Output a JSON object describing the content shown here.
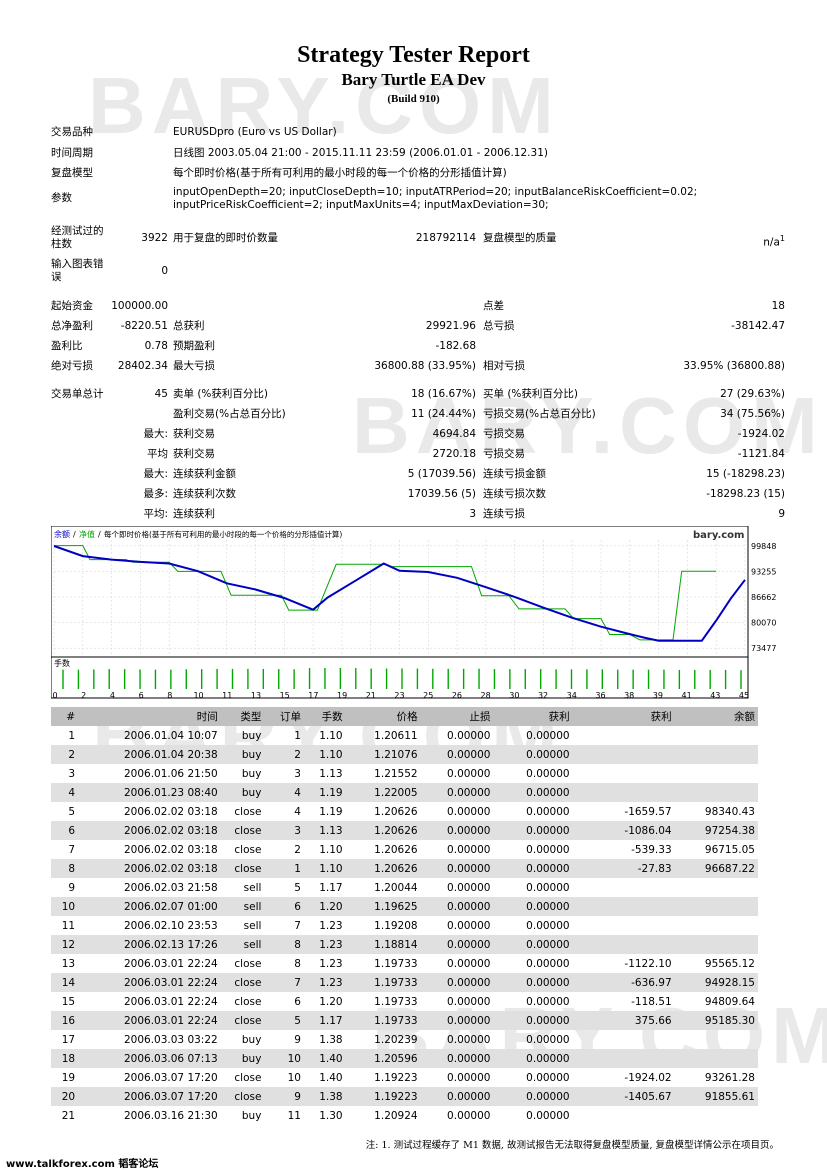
{
  "header": {
    "title": "Strategy Tester Report",
    "subtitle": "Bary Turtle EA Dev",
    "build": "(Build 910)",
    "watermark": "BARY.COM"
  },
  "info": {
    "symbol_label": "交易品种",
    "symbol": "EURUSDpro (Euro vs US Dollar)",
    "period_label": "时间周期",
    "period": "日线图 2003.05.04 21:00 - 2015.11.11 23:59 (2006.01.01 - 2006.12.31)",
    "model_label": "复盘模型",
    "model": "每个即时价格(基于所有可利用的最小时段的每一个价格的分形插值计算)",
    "params_label": "参数",
    "params_line1": "inputOpenDepth=20; inputCloseDepth=10; inputATRPeriod=20; inputBalanceRiskCoefficient=0.02;",
    "params_line2": "inputPriceRiskCoefficient=2; inputMaxUnits=4; inputMaxDeviation=30;",
    "bars_label": "经测试过的柱数",
    "bars": "3922",
    "ticks_label": "用于复盘的即时价数量",
    "ticks": "218792114",
    "quality_label": "复盘模型的质量",
    "quality": "n/a",
    "quality_sup": "1",
    "errors_label": "输入图表错误",
    "errors": "0"
  },
  "stats": {
    "deposit_label": "起始资金",
    "deposit": "100000.00",
    "spread_label": "点差",
    "spread": "18",
    "net_label": "总净盈利",
    "net": "-8220.51",
    "gross_profit_label": "总获利",
    "gross_profit": "29921.96",
    "gross_loss_label": "总亏损",
    "gross_loss": "-38142.47",
    "pf_label": "盈利比",
    "pf": "0.78",
    "payoff_label": "预期盈利",
    "payoff": "-182.68",
    "abs_dd_label": "绝对亏损",
    "abs_dd": "28402.34",
    "max_dd_label": "最大亏损",
    "max_dd": "36800.88 (33.95%)",
    "rel_dd_label": "相对亏损",
    "rel_dd": "33.95% (36800.88)",
    "total_label": "交易单总计",
    "total": "45",
    "short_label": "卖单 (%获利百分比)",
    "short": "18 (16.67%)",
    "long_label": "买单 (%获利百分比)",
    "long": "27 (29.63%)",
    "win_label": "盈利交易(%占总百分比)",
    "win": "11 (24.44%)",
    "loss_label": "亏损交易(%占总百分比)",
    "loss": "34 (75.56%)",
    "max_prefix": "最大:",
    "largest_win_label": "获利交易",
    "largest_win": "4694.84",
    "largest_loss_label": "亏损交易",
    "largest_loss": "-1924.02",
    "avg_prefix": "平均",
    "avg_win_label": "获利交易",
    "avg_win": "2720.18",
    "avg_loss_label": "亏损交易",
    "avg_loss": "-1121.84",
    "max2_prefix": "最大:",
    "cons_win_label": "连续获利金额",
    "cons_win": "5 (17039.56)",
    "cons_loss_label": "连续亏损金额",
    "cons_loss": "15 (-18298.23)",
    "most_prefix": "最多:",
    "cons_win_cnt_label": "连续获利次数",
    "cons_win_cnt": "17039.56 (5)",
    "cons_loss_cnt_label": "连续亏损次数",
    "cons_loss_cnt": "-18298.23 (15)",
    "avg2_prefix": "平均:",
    "avg_cons_win_label": "连续获利",
    "avg_cons_win": "3",
    "avg_cons_loss_label": "连续亏损",
    "avg_cons_loss": "9"
  },
  "chart_data": {
    "type": "line",
    "legend": [
      "余额",
      "净值",
      "每个即时价格(基于所有可利用的最小时段的每一个价格的分形插值计算)"
    ],
    "brand": "bary.com",
    "volume_label": "手数",
    "y_ticks": [
      "99848",
      "93255",
      "86662",
      "80070",
      "73477"
    ],
    "ylim": [
      73477,
      99848
    ],
    "xlim": [
      0,
      46
    ],
    "x_ticks": [
      "0",
      "2",
      "4",
      "6",
      "8",
      "10",
      "11",
      "13",
      "15",
      "17",
      "19",
      "21",
      "23",
      "25",
      "26",
      "28",
      "30",
      "32",
      "34",
      "36",
      "38",
      "39",
      "41",
      "43",
      "45"
    ],
    "series": [
      {
        "name": "余额",
        "color": "#00a800",
        "points": [
          [
            0,
            99900
          ],
          [
            2,
            99900
          ],
          [
            2.5,
            96300
          ],
          [
            5,
            96300
          ],
          [
            5.5,
            95600
          ],
          [
            8,
            95600
          ],
          [
            8.6,
            93262
          ],
          [
            11.6,
            93262
          ],
          [
            12.3,
            87100
          ],
          [
            15.8,
            87100
          ],
          [
            16.3,
            83300
          ],
          [
            18.3,
            83300
          ],
          [
            19.6,
            95100
          ],
          [
            22.9,
            95100
          ],
          [
            23.5,
            94500
          ],
          [
            29,
            94500
          ],
          [
            29.7,
            87000
          ],
          [
            31.6,
            87000
          ],
          [
            32.3,
            83600
          ],
          [
            35.5,
            83600
          ],
          [
            36.1,
            81100
          ],
          [
            38,
            81100
          ],
          [
            38.6,
            77000
          ],
          [
            40,
            77000
          ],
          [
            40.7,
            75600
          ],
          [
            43,
            75600
          ],
          [
            43.6,
            93300
          ],
          [
            46,
            93300
          ]
        ]
      },
      {
        "name": "净值",
        "color": "#0000c0",
        "points": [
          [
            0,
            99800
          ],
          [
            2,
            97200
          ],
          [
            4,
            96300
          ],
          [
            6,
            95700
          ],
          [
            8,
            95300
          ],
          [
            10,
            93300
          ],
          [
            12,
            90200
          ],
          [
            14,
            88600
          ],
          [
            16,
            86400
          ],
          [
            18,
            83400
          ],
          [
            19,
            86500
          ],
          [
            21,
            91000
          ],
          [
            22.9,
            95300
          ],
          [
            24,
            93400
          ],
          [
            26,
            93100
          ],
          [
            28,
            91600
          ],
          [
            30,
            89200
          ],
          [
            32,
            86700
          ],
          [
            34,
            83900
          ],
          [
            36,
            81300
          ],
          [
            38,
            79000
          ],
          [
            40,
            77100
          ],
          [
            41,
            76200
          ],
          [
            42,
            75400
          ],
          [
            44,
            75400
          ],
          [
            45,
            75400
          ],
          [
            46,
            80600
          ],
          [
            47,
            86200
          ],
          [
            48,
            91100
          ]
        ]
      }
    ],
    "volumes": [
      1.1,
      1.1,
      1.13,
      1.19,
      1.19,
      1.13,
      1.1,
      1.1,
      1.17,
      1.2,
      1.23,
      1.23,
      1.23,
      1.23,
      1.2,
      1.17,
      1.38,
      1.4,
      1.4,
      1.38,
      1.3,
      1.3,
      1.3,
      1.3,
      1.25,
      1.25,
      1.25,
      1.25,
      1.2,
      1.2,
      1.2,
      1.2,
      1.15,
      1.15,
      1.15,
      1.15,
      1.1,
      1.1,
      1.1,
      1.1,
      1.05,
      1.05,
      1.05,
      1.05,
      1.0
    ]
  },
  "table": {
    "headers": [
      "#",
      "时间",
      "类型",
      "订单",
      "手数",
      "价格",
      "止损",
      "获利",
      "获利",
      "余额"
    ],
    "rows": [
      [
        "1",
        "2006.01.04 10:07",
        "buy",
        "1",
        "1.10",
        "1.20611",
        "0.00000",
        "0.00000",
        "",
        ""
      ],
      [
        "2",
        "2006.01.04 20:38",
        "buy",
        "2",
        "1.10",
        "1.21076",
        "0.00000",
        "0.00000",
        "",
        ""
      ],
      [
        "3",
        "2006.01.06 21:50",
        "buy",
        "3",
        "1.13",
        "1.21552",
        "0.00000",
        "0.00000",
        "",
        ""
      ],
      [
        "4",
        "2006.01.23 08:40",
        "buy",
        "4",
        "1.19",
        "1.22005",
        "0.00000",
        "0.00000",
        "",
        ""
      ],
      [
        "5",
        "2006.02.02 03:18",
        "close",
        "4",
        "1.19",
        "1.20626",
        "0.00000",
        "0.00000",
        "-1659.57",
        "98340.43"
      ],
      [
        "6",
        "2006.02.02 03:18",
        "close",
        "3",
        "1.13",
        "1.20626",
        "0.00000",
        "0.00000",
        "-1086.04",
        "97254.38"
      ],
      [
        "7",
        "2006.02.02 03:18",
        "close",
        "2",
        "1.10",
        "1.20626",
        "0.00000",
        "0.00000",
        "-539.33",
        "96715.05"
      ],
      [
        "8",
        "2006.02.02 03:18",
        "close",
        "1",
        "1.10",
        "1.20626",
        "0.00000",
        "0.00000",
        "-27.83",
        "96687.22"
      ],
      [
        "9",
        "2006.02.03 21:58",
        "sell",
        "5",
        "1.17",
        "1.20044",
        "0.00000",
        "0.00000",
        "",
        ""
      ],
      [
        "10",
        "2006.02.07 01:00",
        "sell",
        "6",
        "1.20",
        "1.19625",
        "0.00000",
        "0.00000",
        "",
        ""
      ],
      [
        "11",
        "2006.02.10 23:53",
        "sell",
        "7",
        "1.23",
        "1.19208",
        "0.00000",
        "0.00000",
        "",
        ""
      ],
      [
        "12",
        "2006.02.13 17:26",
        "sell",
        "8",
        "1.23",
        "1.18814",
        "0.00000",
        "0.00000",
        "",
        ""
      ],
      [
        "13",
        "2006.03.01 22:24",
        "close",
        "8",
        "1.23",
        "1.19733",
        "0.00000",
        "0.00000",
        "-1122.10",
        "95565.12"
      ],
      [
        "14",
        "2006.03.01 22:24",
        "close",
        "7",
        "1.23",
        "1.19733",
        "0.00000",
        "0.00000",
        "-636.97",
        "94928.15"
      ],
      [
        "15",
        "2006.03.01 22:24",
        "close",
        "6",
        "1.20",
        "1.19733",
        "0.00000",
        "0.00000",
        "-118.51",
        "94809.64"
      ],
      [
        "16",
        "2006.03.01 22:24",
        "close",
        "5",
        "1.17",
        "1.19733",
        "0.00000",
        "0.00000",
        "375.66",
        "95185.30"
      ],
      [
        "17",
        "2006.03.03 03:22",
        "buy",
        "9",
        "1.38",
        "1.20239",
        "0.00000",
        "0.00000",
        "",
        ""
      ],
      [
        "18",
        "2006.03.06 07:13",
        "buy",
        "10",
        "1.40",
        "1.20596",
        "0.00000",
        "0.00000",
        "",
        ""
      ],
      [
        "19",
        "2006.03.07 17:20",
        "close",
        "10",
        "1.40",
        "1.19223",
        "0.00000",
        "0.00000",
        "-1924.02",
        "93261.28"
      ],
      [
        "20",
        "2006.03.07 17:20",
        "close",
        "9",
        "1.38",
        "1.19223",
        "0.00000",
        "0.00000",
        "-1405.67",
        "91855.61"
      ],
      [
        "21",
        "2006.03.16 21:30",
        "buy",
        "11",
        "1.30",
        "1.20924",
        "0.00000",
        "0.00000",
        "",
        ""
      ]
    ]
  },
  "note": "注: 1. 测试过程缓存了 M1 数据, 故测试报告无法取得复盘模型质量, 复盘模型详情公示在项目页。",
  "footer": "www.talkforex.com 韬客论坛"
}
